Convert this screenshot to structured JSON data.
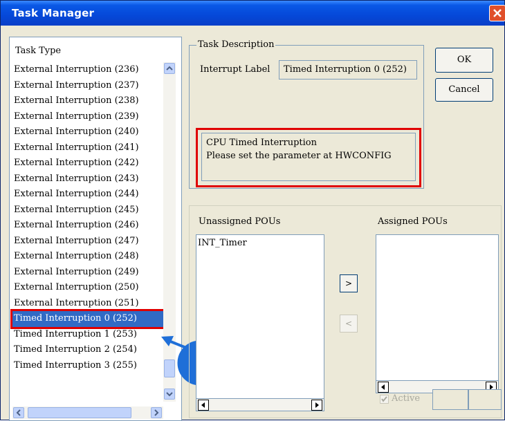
{
  "window": {
    "title": "Task Manager"
  },
  "left": {
    "label": "Task Type",
    "items": [
      "External Interruption (236)",
      "External Interruption (237)",
      "External Interruption (238)",
      "External Interruption (239)",
      "External Interruption (240)",
      "External Interruption (241)",
      "External Interruption (242)",
      "External Interruption (243)",
      "External Interruption (244)",
      "External Interruption (245)",
      "External Interruption (246)",
      "External Interruption (247)",
      "External Interruption (248)",
      "External Interruption (249)",
      "External Interruption (250)",
      "External Interruption (251)",
      "Timed Interruption 0 (252)",
      "Timed Interruption 1 (253)",
      "Timed Interruption 2 (254)",
      "Timed Interruption 3 (255)"
    ],
    "selected_index": 16
  },
  "description": {
    "group_label": "Task Description",
    "interrupt_label": "Interrupt Label",
    "interrupt_value": "Timed Interruption 0 (252)",
    "text_line1": "CPU Timed Interruption",
    "text_line2": "Please set the parameter at HWCONFIG"
  },
  "buttons": {
    "ok": "OK",
    "cancel": "Cancel",
    "move_right": ">",
    "move_left": "<"
  },
  "pous": {
    "unassigned_label": "Unassigned POUs",
    "assigned_label": "Assigned POUs",
    "unassigned_items": [
      "INT_Timer"
    ],
    "active_label": "Active",
    "active_checked": true
  },
  "colors": {
    "highlight": "#e00000",
    "selection": "#316ac5",
    "titlebar": "#0548d8"
  }
}
